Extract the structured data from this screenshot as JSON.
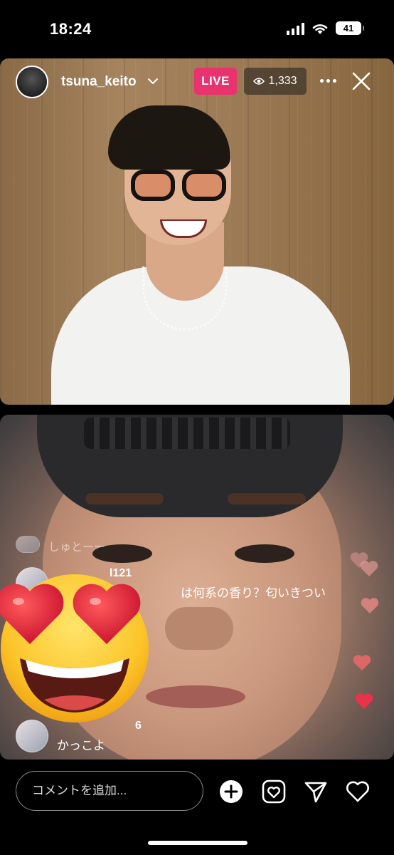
{
  "status_bar": {
    "time": "18:24",
    "battery": "41"
  },
  "live": {
    "username": "tsuna_keito",
    "live_label": "LIVE",
    "viewer_count": "1,333"
  },
  "comments": [
    {
      "user": "しゅとーー",
      "text": ""
    },
    {
      "user": "l121",
      "text": "は何系の香り？匂いきつい"
    },
    {
      "user": "6",
      "text": "かっこよ"
    }
  ],
  "input": {
    "placeholder": "コメントを追加..."
  },
  "icons": {
    "add": "plus-circle-icon",
    "face_filter": "face-heart-icon",
    "share": "paper-plane-icon",
    "like": "heart-icon",
    "reaction": "heart-eyes-emoji-icon"
  },
  "colors": {
    "live_badge": "#e8336f",
    "heart": "#e8334a",
    "background": "#000000"
  }
}
